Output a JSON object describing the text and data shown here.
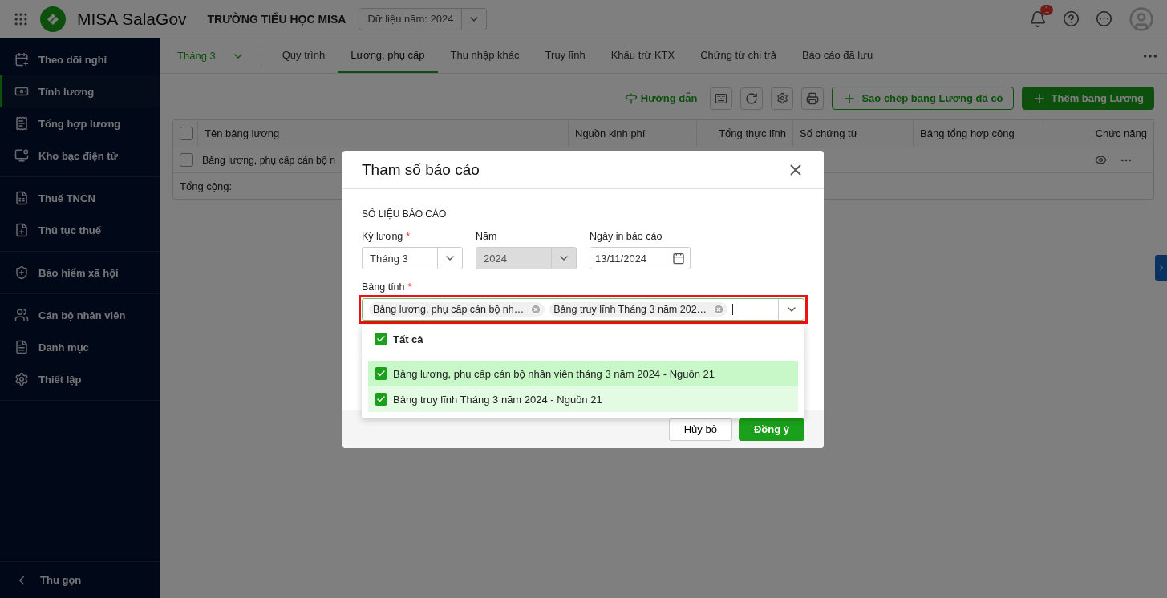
{
  "topbar": {
    "app_name": "MISA SalaGov",
    "organization": "TRƯỜNG TIỂU HỌC MISA",
    "year_select": "Dữ liệu năm: 2024",
    "notification_count": "1"
  },
  "sidebar": {
    "groups": [
      [
        {
          "label": "Theo dõi nghỉ",
          "selected": false
        },
        {
          "label": "Tính lương",
          "selected": true
        },
        {
          "label": "Tổng hợp lương",
          "selected": false
        },
        {
          "label": "Kho bạc điện tử",
          "selected": false
        }
      ],
      [
        {
          "label": "Thuế TNCN",
          "selected": false
        },
        {
          "label": "Thủ tục thuế",
          "selected": false
        }
      ],
      [
        {
          "label": "Bảo hiểm xã hội",
          "selected": false
        }
      ],
      [
        {
          "label": "Cán bộ nhân viên",
          "selected": false
        },
        {
          "label": "Danh mục",
          "selected": false
        },
        {
          "label": "Thiết lập",
          "selected": false
        }
      ]
    ],
    "collapse": "Thu gọn"
  },
  "period_select": "Tháng 3",
  "tabs": [
    {
      "label": "Quy trình",
      "selected": false
    },
    {
      "label": "Lương, phụ cấp",
      "selected": true
    },
    {
      "label": "Thu nhập khác",
      "selected": false
    },
    {
      "label": "Truy lĩnh",
      "selected": false
    },
    {
      "label": "Khấu trừ KTX",
      "selected": false
    },
    {
      "label": "Chứng từ chi trả",
      "selected": false
    },
    {
      "label": "Báo cáo đã lưu",
      "selected": false
    }
  ],
  "toolbar": {
    "guide": "Hướng dẫn",
    "copy_button": "Sao chép bảng Lương đã có",
    "add_button": "Thêm bảng Lương"
  },
  "table": {
    "header_checked": false,
    "columns": [
      "Tên bảng lương",
      "Nguồn kinh phí",
      "Tổng thực lĩnh",
      "Số chứng từ",
      "Bảng tổng hợp công",
      "Chức năng"
    ],
    "rows": [
      {
        "checked": false,
        "name": "Bảng lương, phụ cấp cán bộ n"
      }
    ],
    "total_label": "Tổng cộng:"
  },
  "dialog": {
    "title": "Tham số báo cáo",
    "section": "SỐ LIỆU BÁO CÁO",
    "period": {
      "label": "Kỳ lương",
      "required_mark": "*",
      "value": "Tháng 3"
    },
    "year": {
      "label": "Năm",
      "disabled": true,
      "value": "2024"
    },
    "print_date": {
      "label": "Ngày in báo cáo",
      "value": "13/11/2024"
    },
    "sheets": {
      "label": "Bảng tính",
      "required_mark": "*",
      "tags": [
        "Bảng lương, phụ cấp cán bộ nh…",
        "Bảng truy lĩnh Tháng 3 năm 202…"
      ]
    },
    "dropdown": {
      "select_all": {
        "label": "Tất cả",
        "checked": true
      },
      "options": [
        {
          "label": "Bảng lương, phụ cấp cán bộ nhân viên tháng 3 năm 2024 - Nguồn 21",
          "checked": true,
          "hovered": true
        },
        {
          "label": "Bảng truy lĩnh Tháng 3 năm 2024 - Nguồn 21",
          "checked": true,
          "hovered": false
        }
      ]
    },
    "cancel": "Hủy bỏ",
    "ok": "Đồng ý"
  }
}
